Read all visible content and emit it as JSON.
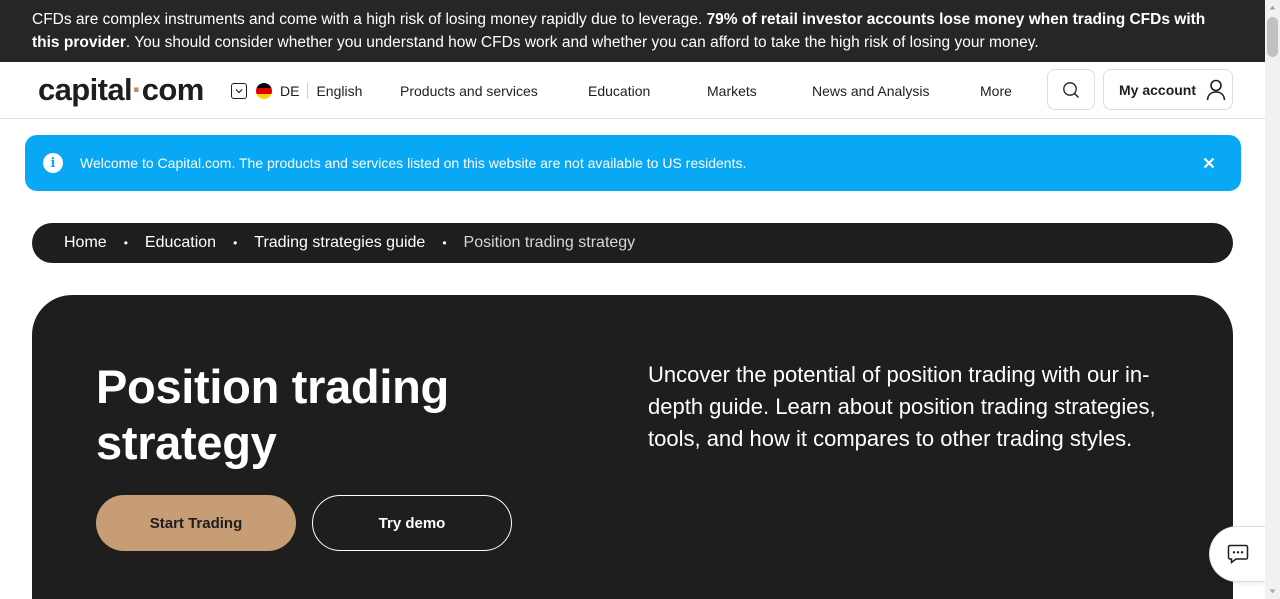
{
  "risk_banner": {
    "text_prefix": "CFDs are complex instruments and come with a high risk of losing money rapidly due to leverage. ",
    "text_bold": "79% of retail investor accounts lose money when trading CFDs with this provider",
    "text_suffix": ". You should consider whether you understand how CFDs work and whether you can afford to take the high risk of losing your money."
  },
  "header": {
    "logo_left": "capital",
    "logo_dot": "·",
    "logo_right": "com",
    "country_code": "DE",
    "language": "English",
    "nav": [
      "Products and services",
      "Education",
      "Markets",
      "News and Analysis",
      "More"
    ],
    "account_label": "My account"
  },
  "notice": {
    "text": "Welcome to Capital.com. The products and services listed on this website are not available to US residents."
  },
  "breadcrumb": {
    "items": [
      "Home",
      "Education",
      "Trading strategies guide",
      "Position trading strategy"
    ],
    "separator": "•"
  },
  "hero": {
    "title": "Position trading strategy",
    "description": "Uncover the potential of position trading with our in-depth guide. Learn about position trading strategies, tools, and how it compares to other trading styles.",
    "primary_button": "Start Trading",
    "secondary_button": "Try demo"
  },
  "colors": {
    "accent": "#c79d76",
    "notice_blue": "#08a8f4",
    "dark": "#1e1e1e",
    "banner_dark": "#262626"
  },
  "icons": [
    "chevron-down-icon",
    "germany-flag-icon",
    "search-icon",
    "user-icon",
    "info-icon",
    "close-icon",
    "chat-icon"
  ]
}
